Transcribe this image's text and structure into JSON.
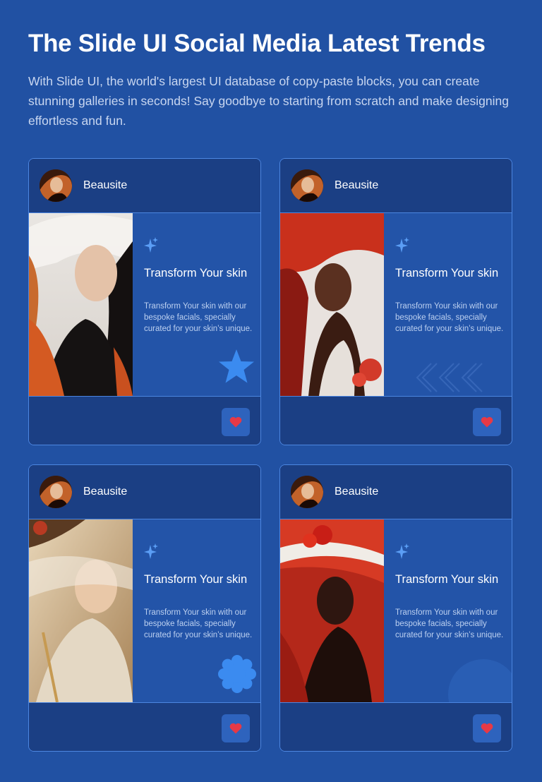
{
  "header": {
    "title": "The Slide UI Social Media Latest Trends",
    "description": "With Slide UI, the world's largest UI database of copy-paste blocks, you can create stunning galleries in seconds! Say goodbye to starting from scratch and make designing effortless and fun."
  },
  "colors": {
    "background": "#2151a3",
    "card_border": "#4c86e0",
    "accent": "#3b8bf0",
    "heart": "#e63946"
  },
  "cards": [
    {
      "author": "Beausite",
      "title": "Transform Your skin",
      "text": "Transform Your skin with our bespoke facials, specially curated for your skin’s unique.",
      "decoration": "star-icon"
    },
    {
      "author": "Beausite",
      "title": "Transform Your skin",
      "text": "Transform Your skin with our bespoke facials, specially curated for your skin’s unique.",
      "decoration": "chevrons-left-icon"
    },
    {
      "author": "Beausite",
      "title": "Transform Your skin",
      "text": "Transform Your skin with our bespoke facials, specially curated for your skin’s unique.",
      "decoration": "flower-badge-icon"
    },
    {
      "author": "Beausite",
      "title": "Transform Your skin",
      "text": "Transform Your skin with our bespoke facials, specially curated for your skin’s unique.",
      "decoration": "circle-shape"
    }
  ]
}
